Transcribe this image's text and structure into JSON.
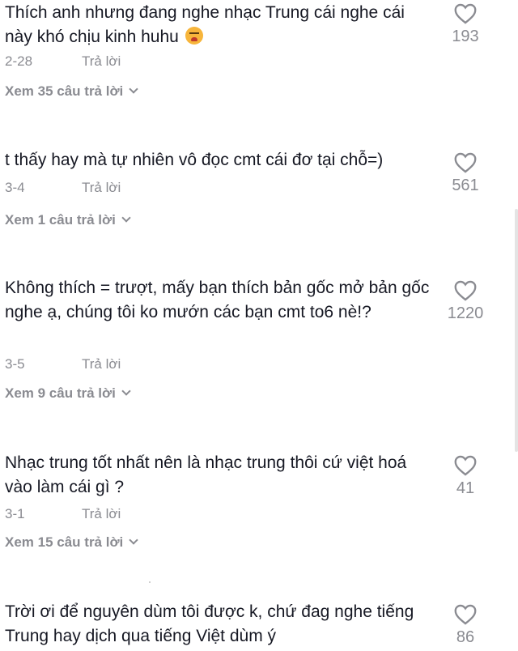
{
  "comments": [
    {
      "text": "Thích anh nhưng đang nghe nhạc Trung cái nghe cái này khó chịu kinh huhu",
      "emoji": "weary-face",
      "date": "2-28",
      "reply_label": "Trả lời",
      "view_replies": "Xem 35 câu trả lời",
      "likes": "193"
    },
    {
      "text": "t thấy hay mà tự nhiên vô đọc cmt cái đơ tại chỗ=)",
      "date": "3-4",
      "reply_label": "Trả lời",
      "view_replies": "Xem 1 câu trả lời",
      "likes": "561"
    },
    {
      "text": "Không thích = trượt, mấy bạn thích bản gốc mở bản gốc nghe ạ, chúng tôi ko mướn các bạn cmt to6 nè!?",
      "date": "3-5",
      "reply_label": "Trả lời",
      "view_replies": "Xem 9 câu trả lời",
      "likes": "1220"
    },
    {
      "text": "Nhạc trung tốt nhất nên là nhạc trung thôi cứ việt hoá vào làm cái gì ?",
      "date": "3-1",
      "reply_label": "Trả lời",
      "view_replies": "Xem 15 câu trả lời",
      "likes": "41"
    },
    {
      "text": "Trời ơi để nguyên dùm tôi được k, chứ đag nghe tiếng Trung hay dịch qua tiếng Việt dùm ý",
      "likes": "86"
    }
  ],
  "icons": {
    "like": "heart-outline-icon",
    "expand": "chevron-down-icon"
  },
  "colors": {
    "text": "#161823",
    "muted": "#8a8b91"
  }
}
